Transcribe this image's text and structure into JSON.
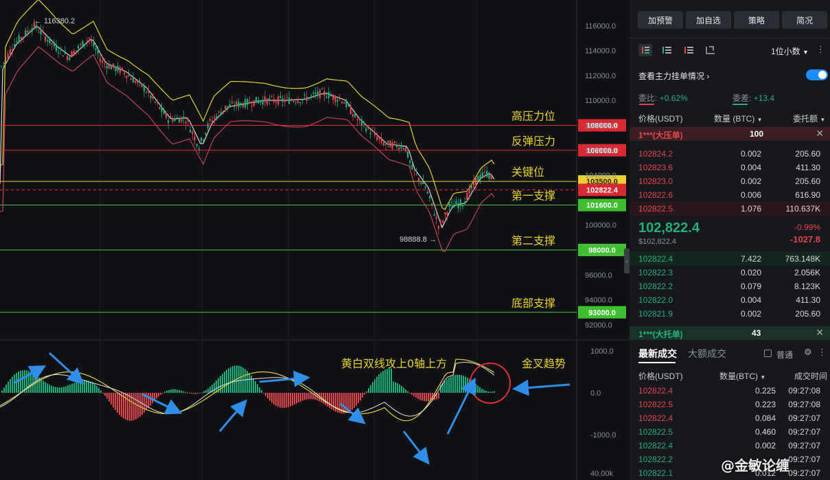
{
  "chart": {
    "price_levels": [
      {
        "label": "高压力位",
        "price": "108000.0",
        "color": "#e0303a"
      },
      {
        "label": "反弹压力",
        "price": "106000.0",
        "color": "#e0303a"
      },
      {
        "label": "关键位",
        "price": "103500.0",
        "color": "#e8d230"
      },
      {
        "label": "",
        "price": "102822.4",
        "color": "#e0303a"
      },
      {
        "label": "第一支撑",
        "price": "101600.0",
        "color": "#4cc83a"
      },
      {
        "label": "第二支撑",
        "price": "98000.0",
        "color": "#4cc83a"
      },
      {
        "label": "底部支撑",
        "price": "93000.0",
        "color": "#4cc83a"
      }
    ],
    "y_ticks": [
      "116000.0",
      "114000.0",
      "112000.0",
      "110000.0",
      "108000.0",
      "106000.0",
      "104000.0",
      "100000.0",
      "96000.0",
      "94000.0",
      "92000.0"
    ],
    "macd_ticks": [
      "1000.0",
      "0.0",
      "-1000.0",
      "40.00k"
    ],
    "high_label": "← 116380.2",
    "low_label": "98888.8 →",
    "macd_note": "黄白双线攻上0轴上方",
    "golden_cross": "金叉趋势",
    "watermark": "@金敏论缠"
  },
  "panel": {
    "top_partial": "",
    "buttons": [
      "加预警",
      "加自选",
      "策略",
      "简况"
    ],
    "precision": "1位小数",
    "main_orders": "查看主力挂单情况",
    "ratio_label": "委比:",
    "ratio_value": "+0.62%",
    "diff_label": "委差:",
    "diff_value": "+13.4",
    "col_price": "价格(USDT)",
    "col_qty": "数量 (BTC)",
    "col_total": "委托额",
    "ask_big": {
      "label": "1***(大压单)",
      "value": "100"
    },
    "asks": [
      {
        "price": "102824.2",
        "qty": "0.002",
        "total": "205.60"
      },
      {
        "price": "102823.6",
        "qty": "0.004",
        "total": "411.30"
      },
      {
        "price": "102823.0",
        "qty": "0.002",
        "total": "205.60"
      },
      {
        "price": "102822.6",
        "qty": "0.006",
        "total": "616.90"
      },
      {
        "price": "102822.5",
        "qty": "1.076",
        "total": "110.637K"
      }
    ],
    "last_price": "102,822.4",
    "last_price_usd": "$102,822.4",
    "change_pct": "-0.99%",
    "change_abs": "-1027.8",
    "bids": [
      {
        "price": "102822.4",
        "qty": "7.422",
        "total": "763.148K"
      },
      {
        "price": "102822.3",
        "qty": "0.020",
        "total": "2.056K"
      },
      {
        "price": "102822.2",
        "qty": "0.079",
        "total": "8.123K"
      },
      {
        "price": "102822.0",
        "qty": "0.004",
        "total": "411.30"
      },
      {
        "price": "102821.9",
        "qty": "0.002",
        "total": "205.60"
      }
    ],
    "bid_big": {
      "label": "1***(大托单)",
      "value": "43"
    },
    "tab_latest": "最新成交",
    "tab_large": "大额成交",
    "normal_label": "普通",
    "trade_col_price": "价格(USDT)",
    "trade_col_qty": "数量(BTC)",
    "trade_col_time": "成交时间",
    "trades": [
      {
        "price": "102822.4",
        "qty": "0.225",
        "time": "09:27:08",
        "side": "sell"
      },
      {
        "price": "102822.5",
        "qty": "0.223",
        "time": "09:27:08",
        "side": "sell"
      },
      {
        "price": "102822.4",
        "qty": "0.084",
        "time": "09:27:07",
        "side": "sell"
      },
      {
        "price": "102822.5",
        "qty": "0.460",
        "time": "09:27:07",
        "side": "buy"
      },
      {
        "price": "102822.4",
        "qty": "0.002",
        "time": "09:27:07",
        "side": "buy"
      },
      {
        "price": "102822.2",
        "qty": "",
        "time": "09:27:07",
        "side": "buy"
      },
      {
        "price": "102822.1",
        "qty": "0.012",
        "time": "09:27:07",
        "side": "buy"
      }
    ]
  }
}
